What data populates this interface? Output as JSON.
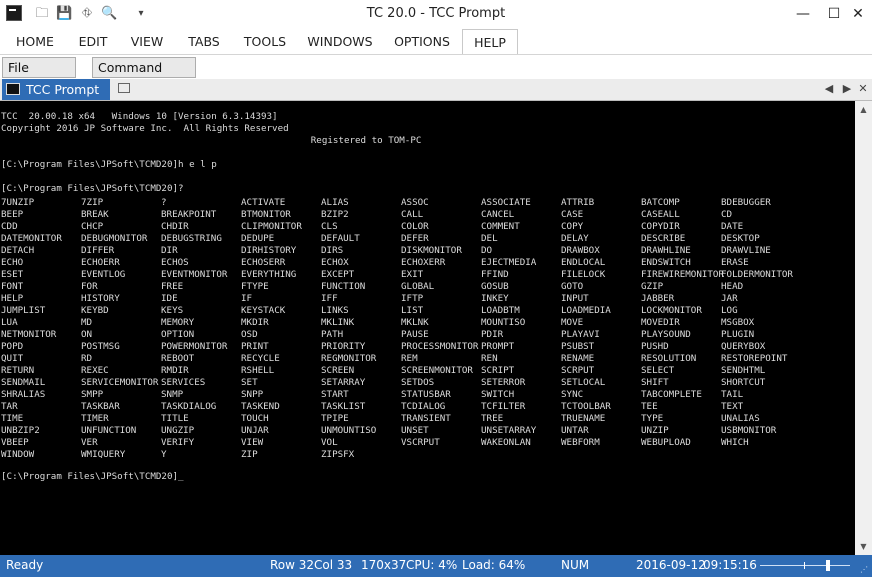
{
  "window": {
    "title": "TC 20.0 - TCC Prompt",
    "minimize": "—",
    "maximize": "☐",
    "close": "✕"
  },
  "ribbon": {
    "tabs": [
      "HOME",
      "EDIT",
      "VIEW",
      "TABS",
      "TOOLS",
      "WINDOWS",
      "OPTIONS",
      "HELP"
    ],
    "active": "HELP"
  },
  "toolbar": {
    "file_explorer": "File Explorer",
    "command_input": "Command Input"
  },
  "doc_tab": {
    "label": "TCC Prompt"
  },
  "console": {
    "lines": [
      "TCC  20.00.18 x64   Windows 10 [Version 6.3.14393]",
      "Copyright 2016 JP Software Inc.  All Rights Reserved",
      "                                                        Registered to TOM-PC",
      "",
      "[C:\\Program Files\\JPSoft\\TCMD20]h e l p",
      "",
      "[C:\\Program Files\\JPSoft\\TCMD20]?"
    ],
    "commands": [
      "7UNZIP",
      "7ZIP",
      "?",
      "ACTIVATE",
      "ALIAS",
      "ASSOC",
      "ASSOCIATE",
      "ATTRIB",
      "BATCOMP",
      "BDEBUGGER",
      "BEEP",
      "BREAK",
      "BREAKPOINT",
      "BTMONITOR",
      "BZIP2",
      "CALL",
      "CANCEL",
      "CASE",
      "CASEALL",
      "CD",
      "CDD",
      "CHCP",
      "CHDIR",
      "CLIPMONITOR",
      "CLS",
      "COLOR",
      "COMMENT",
      "COPY",
      "COPYDIR",
      "DATE",
      "DATEMONITOR",
      "DEBUGMONITOR",
      "DEBUGSTRING",
      "DEDUPE",
      "DEFAULT",
      "DEFER",
      "DEL",
      "DELAY",
      "DESCRIBE",
      "DESKTOP",
      "DETACH",
      "DIFFER",
      "DIR",
      "DIRHISTORY",
      "DIRS",
      "DISKMONITOR",
      "DO",
      "DRAWBOX",
      "DRAWHLINE",
      "DRAWVLINE",
      "ECHO",
      "ECHOERR",
      "ECHOS",
      "ECHOSERR",
      "ECHOX",
      "ECHOXERR",
      "EJECTMEDIA",
      "ENDLOCAL",
      "ENDSWITCH",
      "ERASE",
      "ESET",
      "EVENTLOG",
      "EVENTMONITOR",
      "EVERYTHING",
      "EXCEPT",
      "EXIT",
      "FFIND",
      "FILELOCK",
      "FIREWIREMONITOR",
      "FOLDERMONITOR",
      "FONT",
      "FOR",
      "FREE",
      "FTYPE",
      "FUNCTION",
      "GLOBAL",
      "GOSUB",
      "GOTO",
      "GZIP",
      "HEAD",
      "HELP",
      "HISTORY",
      "IDE",
      "IF",
      "IFF",
      "IFTP",
      "INKEY",
      "INPUT",
      "JABBER",
      "JAR",
      "JUMPLIST",
      "KEYBD",
      "KEYS",
      "KEYSTACK",
      "LINKS",
      "LIST",
      "LOADBTM",
      "LOADMEDIA",
      "LOCKMONITOR",
      "LOG",
      "LUA",
      "MD",
      "MEMORY",
      "MKDIR",
      "MKLINK",
      "MKLNK",
      "MOUNTISO",
      "MOVE",
      "MOVEDIR",
      "MSGBOX",
      "NETMONITOR",
      "ON",
      "OPTION",
      "OSD",
      "PATH",
      "PAUSE",
      "PDIR",
      "PLAYAVI",
      "PLAYSOUND",
      "PLUGIN",
      "POPD",
      "POSTMSG",
      "POWERMONITOR",
      "PRINT",
      "PRIORITY",
      "PROCESSMONITOR",
      "PROMPT",
      "PSUBST",
      "PUSHD",
      "QUERYBOX",
      "QUIT",
      "RD",
      "REBOOT",
      "RECYCLE",
      "REGMONITOR",
      "REM",
      "REN",
      "RENAME",
      "RESOLUTION",
      "RESTOREPOINT",
      "RETURN",
      "REXEC",
      "RMDIR",
      "RSHELL",
      "SCREEN",
      "SCREENMONITOR",
      "SCRIPT",
      "SCRPUT",
      "SELECT",
      "SENDHTML",
      "SENDMAIL",
      "SERVICEMONITOR",
      "SERVICES",
      "SET",
      "SETARRAY",
      "SETDOS",
      "SETERROR",
      "SETLOCAL",
      "SHIFT",
      "SHORTCUT",
      "SHRALIAS",
      "SMPP",
      "SNMP",
      "SNPP",
      "START",
      "STATUSBAR",
      "SWITCH",
      "SYNC",
      "TABCOMPLETE",
      "TAIL",
      "TAR",
      "TASKBAR",
      "TASKDIALOG",
      "TASKEND",
      "TASKLIST",
      "TCDIALOG",
      "TCFILTER",
      "TCTOOLBAR",
      "TEE",
      "TEXT",
      "TIME",
      "TIMER",
      "TITLE",
      "TOUCH",
      "TPIPE",
      "TRANSIENT",
      "TREE",
      "TRUENAME",
      "TYPE",
      "UNALIAS",
      "UNBZIP2",
      "UNFUNCTION",
      "UNGZIP",
      "UNJAR",
      "UNMOUNTISO",
      "UNSET",
      "UNSETARRAY",
      "UNTAR",
      "UNZIP",
      "USBMONITOR",
      "VBEEP",
      "VER",
      "VERIFY",
      "VIEW",
      "VOL",
      "VSCRPUT",
      "WAKEONLAN",
      "WEBFORM",
      "WEBUPLOAD",
      "WHICH",
      "WINDOW",
      "WMIQUERY",
      "Y",
      "ZIP",
      "ZIPSFX"
    ],
    "final_prompt": "[C:\\Program Files\\JPSoft\\TCMD20]_"
  },
  "status": {
    "ready": "Ready",
    "row": "Row 32",
    "col": "Col 33",
    "size": "170x37",
    "cpu": "CPU:  4%",
    "load": "Load: 64%",
    "num": "NUM",
    "date": "2016-09-12",
    "time": "09:15:16"
  },
  "icons": {
    "app": "tcc-app-icon",
    "qa": [
      "folder-icon",
      "save-icon",
      "binoculars-icon",
      "search-icon",
      "dropdown-icon"
    ]
  }
}
